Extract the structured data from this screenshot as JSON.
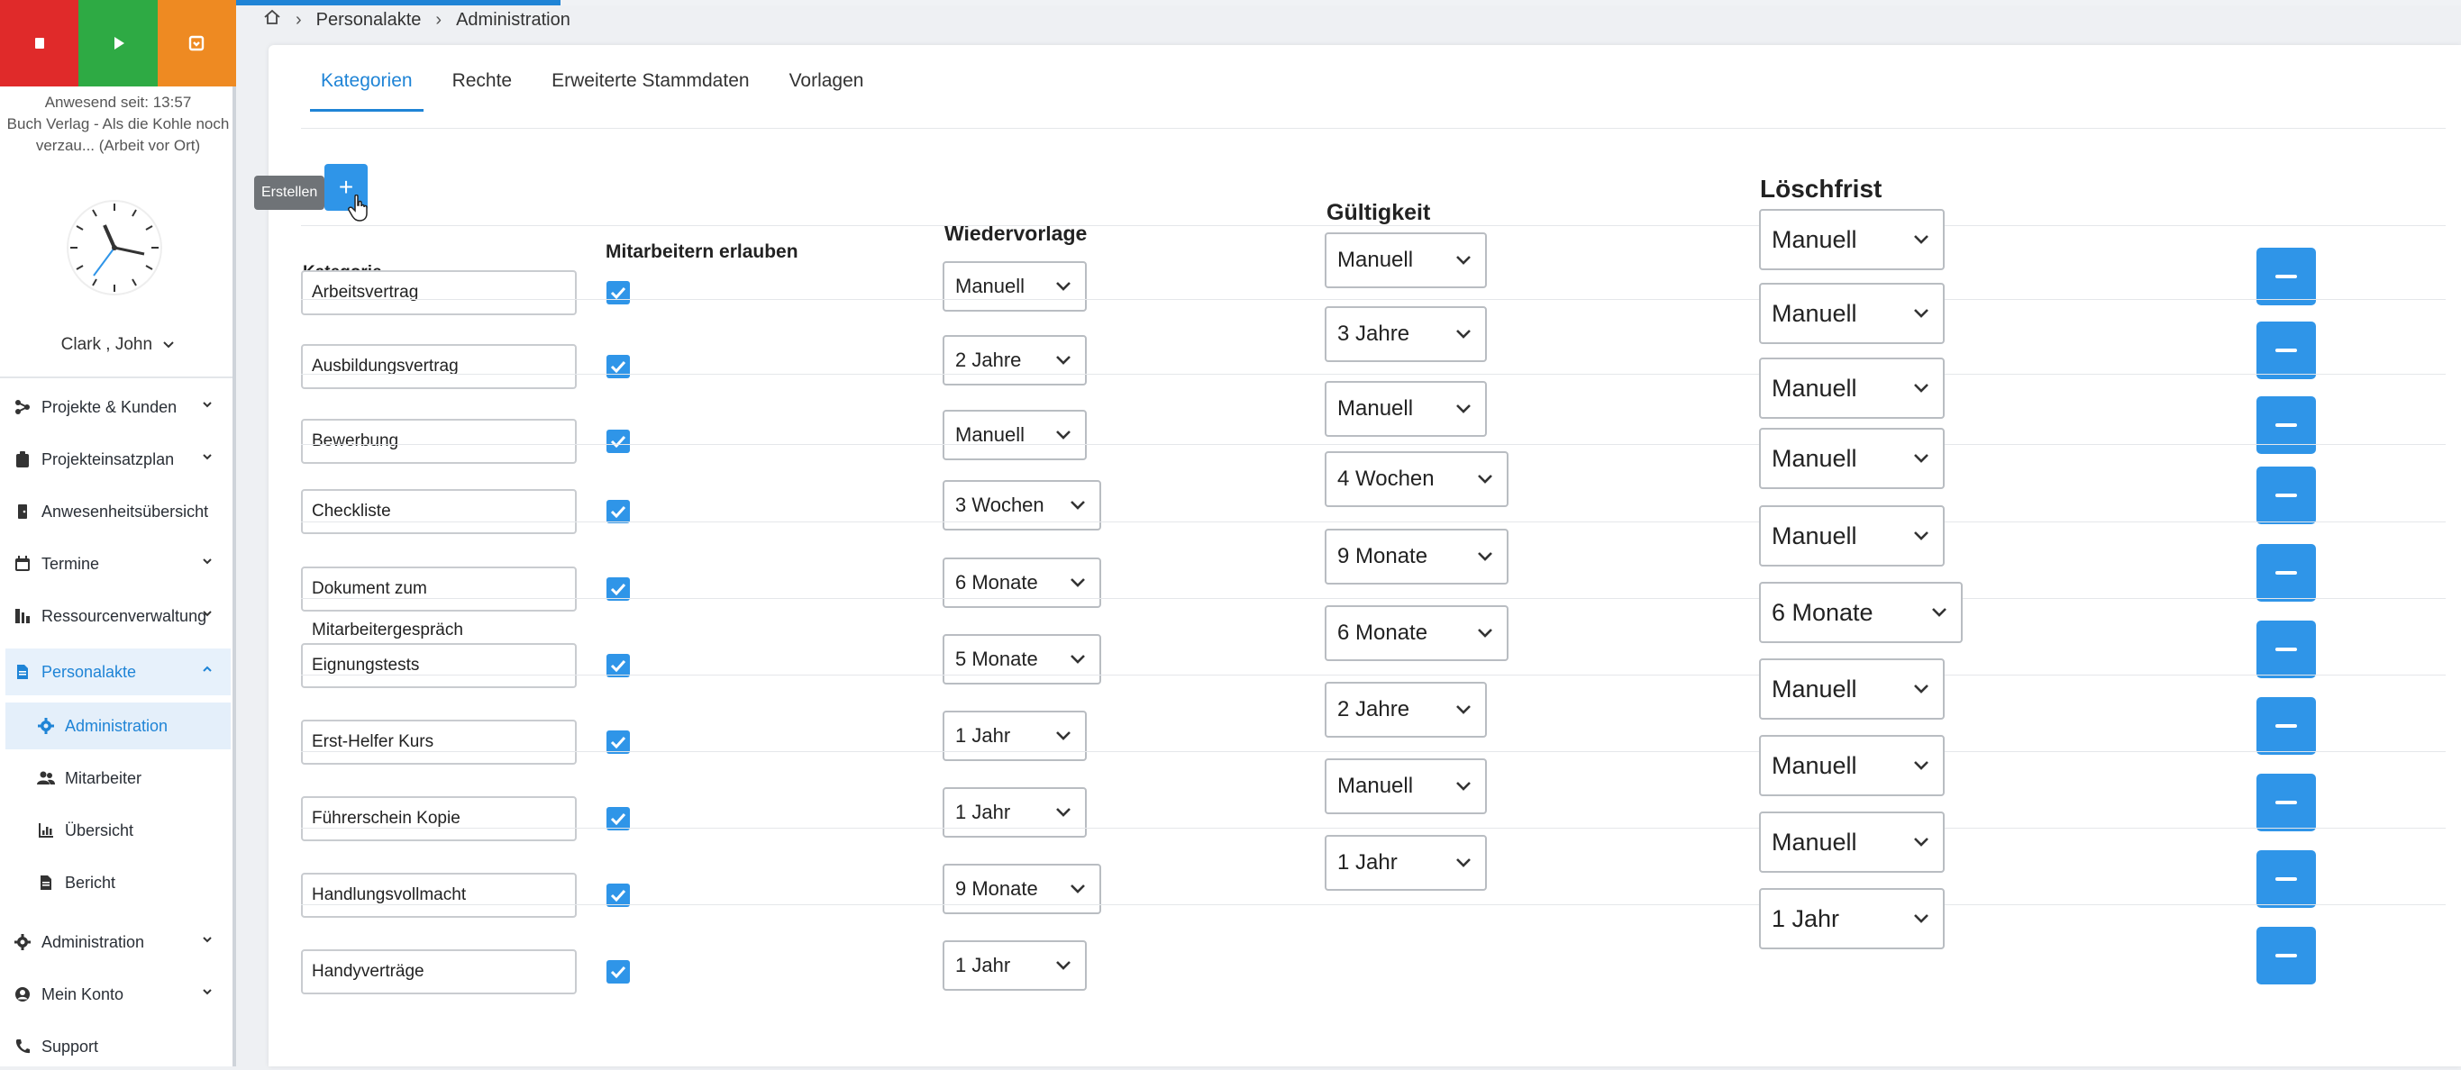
{
  "status_bar": {
    "colors": {
      "stop": "#e02a2a",
      "play": "#2eaa44",
      "pause": "#ee8a22"
    }
  },
  "presence": {
    "line1": "Anwesend seit: 13:57",
    "line2": "Buch Verlag - Als die Kohle noch",
    "line3": "verzau... (Arbeit vor Ort)"
  },
  "user": {
    "name": "Clark , John"
  },
  "nav": [
    {
      "label": "Projekte & Kunden",
      "icon": "project-icon"
    },
    {
      "label": "Projekteinsatzplan",
      "icon": "clipboard-icon"
    },
    {
      "label": "Anwesenheitsübersicht",
      "icon": "door-icon"
    },
    {
      "label": "Termine",
      "icon": "calendar-icon"
    },
    {
      "label": "Ressourcenverwaltung",
      "icon": "resource-icon"
    },
    {
      "label": "Personalakte",
      "icon": "file-icon"
    },
    {
      "label": "Administration",
      "icon": "gear-icon"
    },
    {
      "label": "Mitarbeiter",
      "icon": "users-icon"
    },
    {
      "label": "Übersicht",
      "icon": "chart-icon"
    },
    {
      "label": "Bericht",
      "icon": "report-icon"
    },
    {
      "label": "Administration",
      "icon": "gear-icon"
    },
    {
      "label": "Mein Konto",
      "icon": "account-icon"
    },
    {
      "label": "Support",
      "icon": "phone-icon"
    }
  ],
  "breadcrumb": {
    "item1": "Personalakte",
    "item2": "Administration"
  },
  "tabs": [
    "Kategorien",
    "Rechte",
    "Erweiterte Stammdaten",
    "Vorlagen"
  ],
  "toolbar": {
    "tooltip": "Erstellen",
    "add_label": "+"
  },
  "columns": {
    "kategorie": "Kategorie",
    "mitarbeiter": "Mitarbeitern erlauben",
    "wiedervorlage": "Wiedervorlage",
    "gueltigkeit": "Gültigkeit",
    "loeschfrist": "Löschfrist"
  },
  "rows": [
    {
      "kategorie": "Arbeitsvertrag",
      "allowed": true,
      "wiedervorlage": "Manuell",
      "gueltigkeit": "Manuell",
      "loeschfrist": "Manuell"
    },
    {
      "kategorie": "Ausbildungsvertrag",
      "allowed": true,
      "wiedervorlage": "2 Jahre",
      "gueltigkeit": "3 Jahre",
      "loeschfrist": "Manuell"
    },
    {
      "kategorie": "Bewerbung",
      "allowed": true,
      "wiedervorlage": "Manuell",
      "gueltigkeit": "Manuell",
      "loeschfrist": "Manuell"
    },
    {
      "kategorie": "Checkliste",
      "allowed": true,
      "wiedervorlage": "3 Wochen",
      "gueltigkeit": "4 Wochen",
      "loeschfrist": "Manuell"
    },
    {
      "kategorie": "Dokument zum Mitarbeitergespräch",
      "allowed": true,
      "wiedervorlage": "6 Monate",
      "gueltigkeit": "9 Monate",
      "loeschfrist": "Manuell"
    },
    {
      "kategorie": "Eignungstests",
      "allowed": true,
      "wiedervorlage": "5 Monate",
      "gueltigkeit": "6 Monate",
      "loeschfrist": "6 Monate"
    },
    {
      "kategorie": "Erst-Helfer Kurs",
      "allowed": true,
      "wiedervorlage": "1 Jahr",
      "gueltigkeit": "2 Jahre",
      "loeschfrist": "Manuell"
    },
    {
      "kategorie": "Führerschein Kopie",
      "allowed": true,
      "wiedervorlage": "1 Jahr",
      "gueltigkeit": "Manuell",
      "loeschfrist": "Manuell"
    },
    {
      "kategorie": "Handlungsvollmacht",
      "allowed": true,
      "wiedervorlage": "9 Monate",
      "gueltigkeit": "1 Jahr",
      "loeschfrist": "Manuell"
    },
    {
      "kategorie": "Handyverträge",
      "allowed": true,
      "wiedervorlage": "1 Jahr",
      "gueltigkeit": "",
      "loeschfrist": "1 Jahr"
    }
  ],
  "accent": "#2f95e8"
}
